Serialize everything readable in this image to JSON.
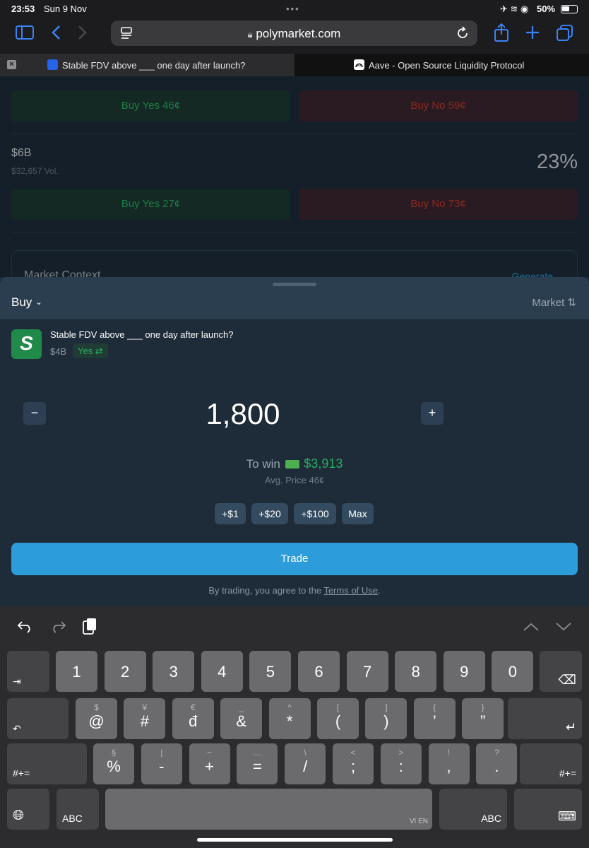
{
  "status_bar": {
    "time": "23:53",
    "date": "Sun 9 Nov",
    "battery": "50%"
  },
  "browser": {
    "url": "polymarket.com",
    "tabs": [
      {
        "title": "Stable FDV above ___ one day after launch?"
      },
      {
        "title": "Aave - Open Source Liquidity Protocol"
      }
    ]
  },
  "page": {
    "row1": {
      "yes_label": "Buy Yes 46¢",
      "no_label": "Buy No 59¢"
    },
    "row2": {
      "title": "$6B",
      "volume": "$32,657 Vol.",
      "percent": "23%",
      "yes_label": "Buy Yes 27¢",
      "no_label": "Buy No 73¢"
    },
    "context_title": "Market Context",
    "context_action": "Generate"
  },
  "sheet": {
    "mode": "Buy",
    "order_type": "Market",
    "market_title": "Stable FDV above ___ one day after launch?",
    "outcome_value": "$4B",
    "outcome_side": "Yes",
    "amount": "1,800",
    "to_win_label": "To win",
    "to_win_value": "$3,913",
    "avg_price": "Avg. Price 46¢",
    "quick_amounts": [
      "+$1",
      "+$20",
      "+$100",
      "Max"
    ],
    "trade_label": "Trade",
    "terms_prefix": "By trading, you agree to the",
    "terms_link": "Terms of Use",
    "terms_suffix": "."
  },
  "keyboard": {
    "row1": [
      "1",
      "2",
      "3",
      "4",
      "5",
      "6",
      "7",
      "8",
      "9",
      "0"
    ],
    "row2": [
      {
        "big": "@",
        "small": "$"
      },
      {
        "big": "#",
        "small": "¥"
      },
      {
        "big": "đ",
        "small": "€"
      },
      {
        "big": "&",
        "small": "_"
      },
      {
        "big": "*",
        "small": "^"
      },
      {
        "big": "(",
        "small": "["
      },
      {
        "big": ")",
        "small": "]"
      },
      {
        "big": "’",
        "small": "{"
      },
      {
        "big": "”",
        "small": "}"
      }
    ],
    "row3": [
      {
        "big": "%",
        "small": "§"
      },
      {
        "big": "-",
        "small": "|"
      },
      {
        "big": "+",
        "small": "~"
      },
      {
        "big": "=",
        "small": "…"
      },
      {
        "big": "/",
        "small": "\\"
      },
      {
        "big": ";",
        "small": "<"
      },
      {
        "big": ":",
        "small": ">"
      },
      {
        "big": ",",
        "small": "!"
      },
      {
        "big": ".",
        "small": "?"
      }
    ],
    "shift_label": "#+=",
    "abc_label": "ABC",
    "space_label": "VI EN"
  }
}
